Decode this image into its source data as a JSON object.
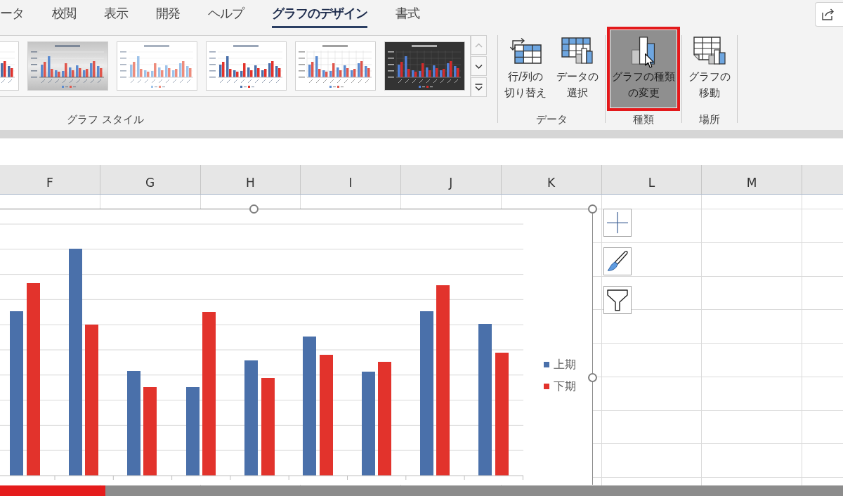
{
  "ribbon": {
    "tabs": [
      {
        "label": "ータ",
        "selected": false
      },
      {
        "label": "校閲",
        "selected": false
      },
      {
        "label": "表示",
        "selected": false
      },
      {
        "label": "開発",
        "selected": false
      },
      {
        "label": "ヘルプ",
        "selected": false
      },
      {
        "label": "グラフのデザイン",
        "selected": true
      },
      {
        "label": "書式",
        "selected": false
      }
    ],
    "style_gallery": {
      "thumbnails": [
        {
          "kind": "plain"
        },
        {
          "kind": "shaded"
        },
        {
          "kind": "pale"
        },
        {
          "kind": "plain"
        },
        {
          "kind": "gridded"
        },
        {
          "kind": "dark"
        }
      ],
      "scroll_buttons": [
        {
          "kind": "up",
          "disabled": true
        },
        {
          "kind": "down",
          "disabled": false
        },
        {
          "kind": "more",
          "disabled": false
        }
      ],
      "label": "グラフ スタイル"
    },
    "groups": [
      {
        "label": "データ",
        "buttons": [
          {
            "kind": "switch",
            "lines": [
              "行/列の",
              "切り替え"
            ],
            "highlighted": false,
            "callout": false
          },
          {
            "kind": "select",
            "lines": [
              "データの",
              "選択"
            ],
            "highlighted": false,
            "callout": false
          }
        ]
      },
      {
        "label": "種類",
        "buttons": [
          {
            "kind": "type",
            "lines": [
              "グラフの種類",
              "の変更"
            ],
            "highlighted": true,
            "callout": true
          }
        ]
      },
      {
        "label": "場所",
        "buttons": [
          {
            "kind": "move",
            "lines": [
              "グラフの",
              "移動"
            ],
            "highlighted": false,
            "callout": false
          }
        ]
      }
    ]
  },
  "sheet": {
    "columns": [
      "F",
      "G",
      "H",
      "I",
      "J",
      "K",
      "L",
      "M"
    ]
  },
  "chart": {
    "legend": [
      {
        "label": "上期",
        "color": "#4a70aa"
      },
      {
        "label": "下期",
        "color": "#e2332c"
      }
    ]
  },
  "progress": {
    "level": 0.125
  }
}
